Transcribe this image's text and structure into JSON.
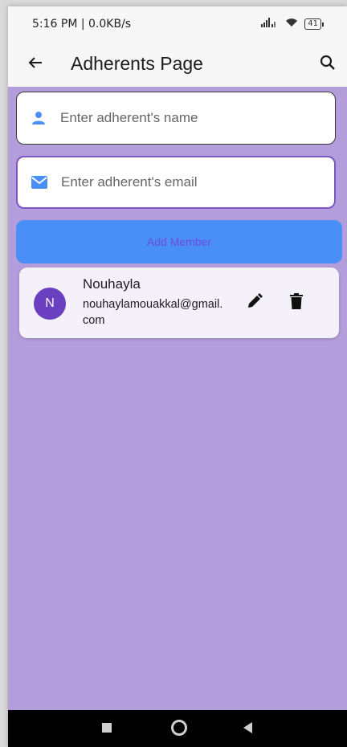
{
  "status_bar": {
    "time": "5:16 PM | 0.0KB/s",
    "battery": "41"
  },
  "app_bar": {
    "title": "Adherents Page",
    "back_icon": "arrow-back-icon",
    "search_icon": "search-icon"
  },
  "form": {
    "name_placeholder": "Enter adherent's name",
    "email_placeholder": "Enter adherent's email",
    "add_button_label": "Add Member"
  },
  "members": [
    {
      "initial": "N",
      "name": "Nouhayla",
      "email": "nouhaylamouakkal@gmail.com"
    }
  ],
  "colors": {
    "background": "#b39ddb",
    "accent": "#4a8ff8",
    "avatar": "#6a3fc0",
    "focused_border": "#7e57c2"
  }
}
